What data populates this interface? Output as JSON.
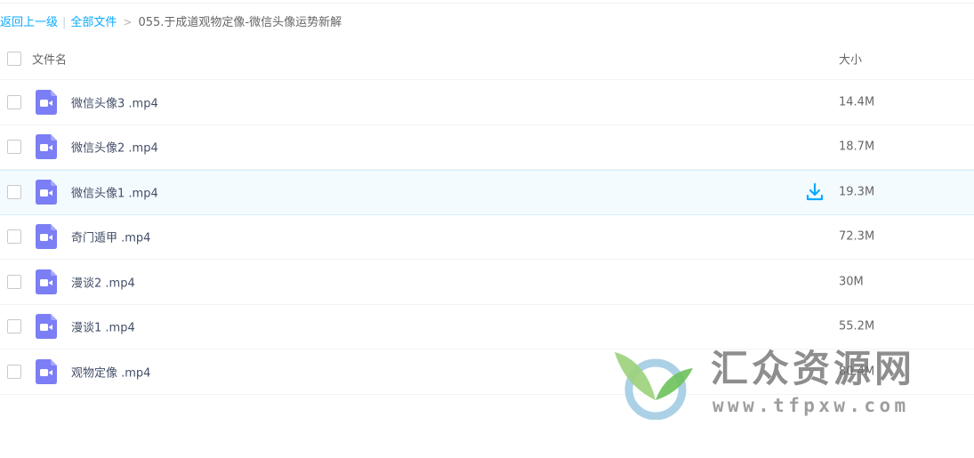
{
  "breadcrumb": {
    "back_label": "返回上一级",
    "separator_bar": "|",
    "all_files_label": "全部文件",
    "separator_arrow": ">",
    "current_folder": "055.于成道观物定像-微信头像运势新解"
  },
  "table": {
    "headers": {
      "name": "文件名",
      "size": "大小"
    },
    "rows": [
      {
        "name": "微信头像3 .mp4",
        "size": "14.4M",
        "icon": "video-file-icon"
      },
      {
        "name": "微信头像2 .mp4",
        "size": "18.7M",
        "icon": "video-file-icon"
      },
      {
        "name": "微信头像1 .mp4",
        "size": "19.3M",
        "icon": "video-file-icon",
        "hovered": true,
        "action_icon": "download-icon"
      },
      {
        "name": "奇门遁甲 .mp4",
        "size": "72.3M",
        "icon": "video-file-icon"
      },
      {
        "name": "漫谈2 .mp4",
        "size": "30M",
        "icon": "video-file-icon"
      },
      {
        "name": "漫谈1 .mp4",
        "size": "55.2M",
        "icon": "video-file-icon"
      },
      {
        "name": "观物定像 .mp4",
        "size": "80.4M",
        "icon": "video-file-icon"
      }
    ]
  },
  "watermark": {
    "title": "汇众资源网",
    "url": "www.tfpxw.com"
  },
  "colors": {
    "link": "#09aaff",
    "file_icon": "#7b7ef4",
    "hover_row": "#f4fbff",
    "download": "#09aaff"
  }
}
